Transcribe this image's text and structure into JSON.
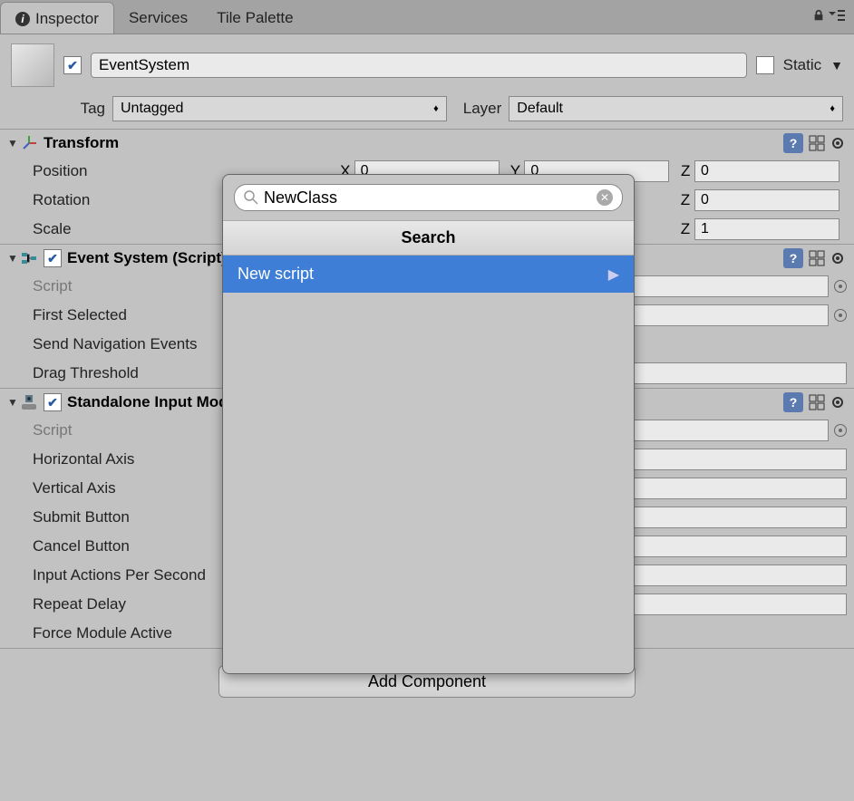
{
  "tabs": {
    "inspector": "Inspector",
    "services": "Services",
    "tile_palette": "Tile Palette"
  },
  "gameobject": {
    "name": "EventSystem",
    "static_label": "Static"
  },
  "tag_row": {
    "tag_label": "Tag",
    "tag_value": "Untagged",
    "layer_label": "Layer",
    "layer_value": "Default"
  },
  "transform": {
    "title": "Transform",
    "position_label": "Position",
    "rotation_label": "Rotation",
    "scale_label": "Scale",
    "x_label": "X",
    "y_label": "Y",
    "z_label": "Z",
    "pos_x": "0",
    "pos_y": "0",
    "pos_z": "0",
    "rot_z": "0",
    "scale_z": "1"
  },
  "event_system": {
    "title": "Event System (Script)",
    "script_label": "Script",
    "first_selected_label": "First Selected",
    "send_nav_label": "Send Navigation Events",
    "drag_threshold_label": "Drag Threshold"
  },
  "standalone": {
    "title": "Standalone Input Module (Script)",
    "script_label": "Script",
    "horizontal_label": "Horizontal Axis",
    "vertical_label": "Vertical Axis",
    "submit_label": "Submit Button",
    "cancel_label": "Cancel Button",
    "input_actions_label": "Input Actions Per Second",
    "repeat_delay_label": "Repeat Delay",
    "force_module_label": "Force Module Active"
  },
  "add_component_label": "Add Component",
  "popup": {
    "search_value": "NewClass",
    "header": "Search",
    "item": "New script"
  }
}
